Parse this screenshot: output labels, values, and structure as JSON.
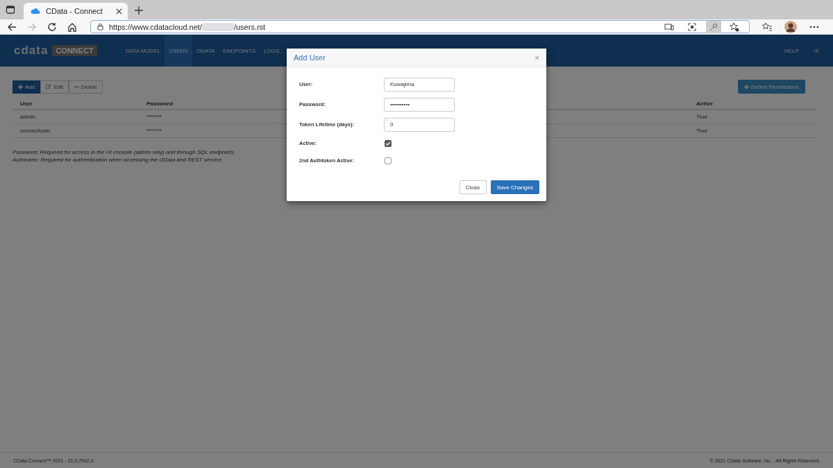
{
  "browser": {
    "tab_title": "CData - Connect",
    "url_start": "https://www.cdatacloud.net/",
    "url_end": "/users.rst"
  },
  "app": {
    "logo": "cdata",
    "logo_badge": "CONNECT",
    "nav": [
      {
        "label": "DATA MODEL",
        "selected": false
      },
      {
        "label": "USERS",
        "selected": true
      },
      {
        "label": "ODATA",
        "selected": false
      },
      {
        "label": "ENDPOINTS",
        "selected": false
      },
      {
        "label": "LOGS",
        "selected": false
      }
    ],
    "help": "HELP"
  },
  "toolbar": {
    "add": "Add",
    "edit": "Edit",
    "delete": "Delete",
    "permissions": "Define Permissions"
  },
  "table": {
    "columns": [
      "User",
      "Password",
      "Active"
    ],
    "rows": [
      [
        "admin",
        "*******",
        "True"
      ],
      [
        "connectuser",
        "*******",
        "True"
      ]
    ]
  },
  "notes": [
    "Password: Required for access in the UI console (admin only) and through SQL endpoints.",
    "Authtoken: Required for authentication when accessing the OData and REST service."
  ],
  "footer": {
    "left": "CData Connect™ 2021 - 21.0.7902.0",
    "right": "© 2021 CData Software, Inc. - All Rights Reserved."
  },
  "dialog": {
    "title": "Add User",
    "close_glyph": "×",
    "fields": [
      {
        "kind": "text",
        "label": "User:",
        "value": "Kuwajima"
      },
      {
        "kind": "text",
        "label": "Password:",
        "value": "••••••••••"
      },
      {
        "kind": "text",
        "label": "Token Lifetime (days):",
        "value": "0"
      },
      {
        "kind": "checkbox",
        "label": "Active:",
        "checked": true
      },
      {
        "kind": "checkbox",
        "label": "2nd Authtoken Active:",
        "checked": false
      }
    ],
    "buttons": [
      "Close",
      "Save Changes"
    ]
  }
}
